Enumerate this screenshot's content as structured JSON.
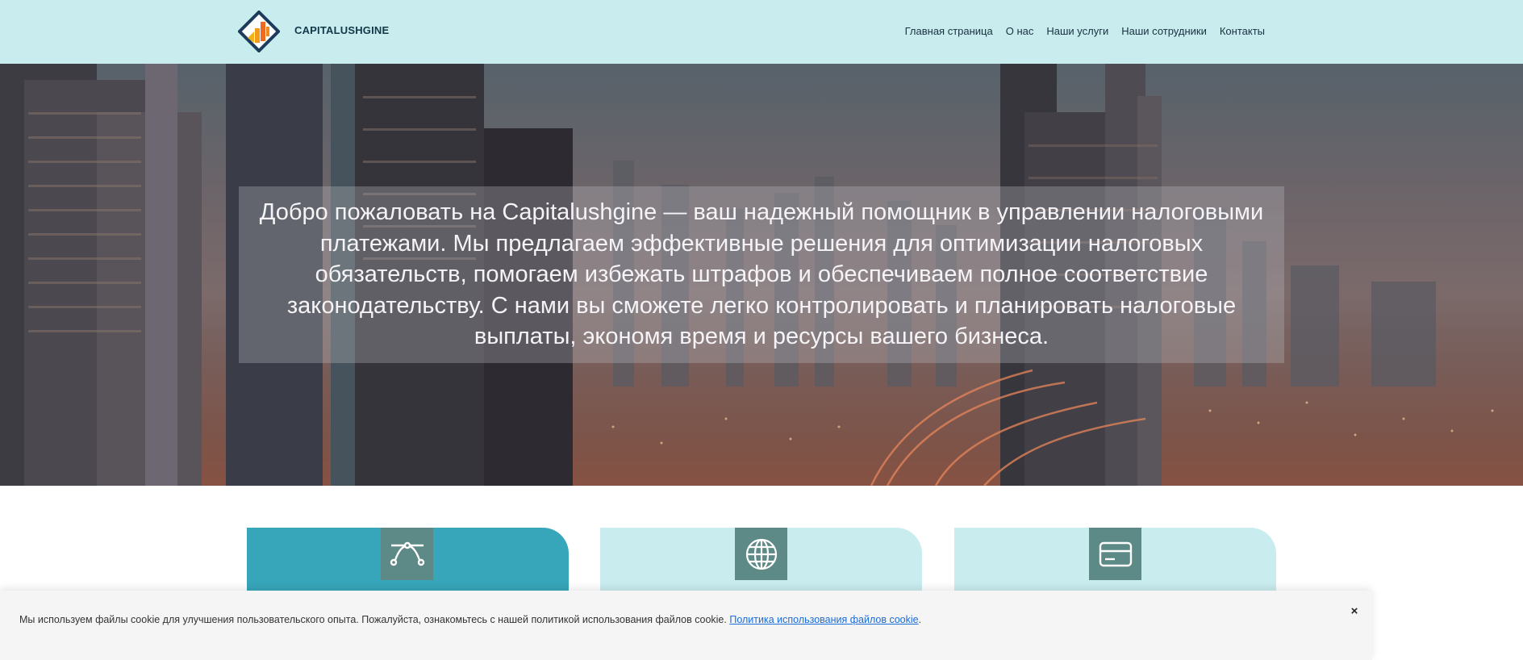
{
  "header": {
    "brand": "CAPITALUSHGINE",
    "nav": [
      {
        "label": "Главная страница"
      },
      {
        "label": "О нас"
      },
      {
        "label": "Наши услуги"
      },
      {
        "label": "Наши сотрудники"
      },
      {
        "label": "Контакты"
      }
    ]
  },
  "hero": {
    "text": "Добро пожаловать на Capitalushgine — ваш надежный помощник в управлении налоговыми платежами. Мы предлагаем эффективные решения для оптимизации налоговых обязательств, помогаем избежать штрафов и обеспечиваем полное соответствие законодательству. С нами вы сможете легко контролировать и планировать налоговые выплаты, экономя время и ресурсы вашего бизнеса."
  },
  "cards": [
    {
      "icon": "bezier-curve-icon"
    },
    {
      "icon": "globe-icon"
    },
    {
      "icon": "credit-card-icon"
    }
  ],
  "cookie": {
    "text": "Мы используем файлы cookie для улучшения пользовательского опыта. Пожалуйста, ознакомьтесь с нашей политикой использования файлов cookie.",
    "link": "Политика использования файлов cookie",
    "suffix": ".",
    "close": "×"
  },
  "colors": {
    "header_bg": "#c9ecee",
    "card_accent": "#37a6ba",
    "card_light": "#c9ecee",
    "icon_bg": "#5d8a86",
    "brand_text": "#12384a",
    "link": "#1a6cd6"
  }
}
